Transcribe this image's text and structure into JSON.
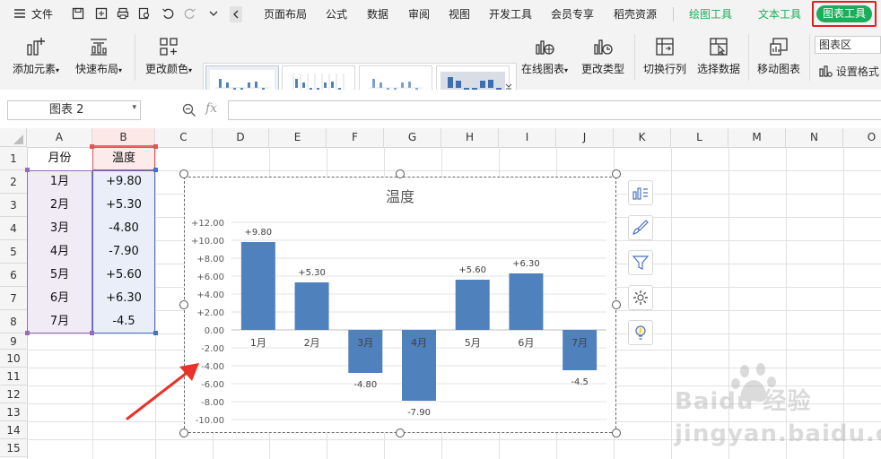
{
  "menu": {
    "file": "文件",
    "tabs": [
      "页面布局",
      "公式",
      "数据",
      "审阅",
      "视图",
      "开发工具",
      "会员专享",
      "稻壳资源"
    ],
    "draw_tools": "绘图工具",
    "text_tools": "文本工具",
    "chart_tools": "图表工具"
  },
  "ribbon": {
    "add_element": "添加元素",
    "quick_layout": "快速布局",
    "change_color": "更改颜色",
    "online_chart": "在线图表",
    "change_type": "更改类型",
    "switch_row_col": "切换行列",
    "select_data": "选择数据",
    "move_chart": "移动图表",
    "chart_area": "图表区",
    "set_format": "设置格式"
  },
  "formula_bar": {
    "name_box": "图表 2",
    "fx": "fx"
  },
  "columns": [
    "A",
    "B",
    "C",
    "D",
    "E",
    "F",
    "G",
    "H",
    "I",
    "J",
    "K",
    "L",
    "M",
    "N",
    "O"
  ],
  "rows": [
    "1",
    "2",
    "3",
    "4",
    "5",
    "6",
    "7",
    "8",
    "9",
    "10",
    "11",
    "12",
    "13",
    "14",
    "15"
  ],
  "table": {
    "header_month": "月份",
    "header_temp": "温度",
    "months": [
      "1月",
      "2月",
      "3月",
      "4月",
      "5月",
      "6月",
      "7月"
    ],
    "temps": [
      "+9.80",
      "+5.30",
      "-4.80",
      "-7.90",
      "+5.60",
      "+6.30",
      "-4.5"
    ]
  },
  "chart_data": {
    "type": "bar",
    "title": "温度",
    "categories": [
      "1月",
      "2月",
      "3月",
      "4月",
      "5月",
      "6月",
      "7月"
    ],
    "values": [
      9.8,
      5.3,
      -4.8,
      -7.9,
      5.6,
      6.3,
      -4.5
    ],
    "data_labels": [
      "+9.80",
      "+5.30",
      "-4.80",
      "-7.90",
      "+5.60",
      "+6.30",
      "-4.5"
    ],
    "yticks": [
      "+12.00",
      "+10.00",
      "+8.00",
      "+6.00",
      "+4.00",
      "+2.00",
      "0.00",
      "-2.00",
      "-4.00",
      "-6.00",
      "-8.00",
      "-10.00"
    ],
    "ylim": [
      -10,
      12
    ],
    "grid": true,
    "bar_color": "#4f81bd"
  },
  "colors": {
    "accent_green": "#1aad5a",
    "highlight_red": "#e02020",
    "arrow_red": "#e8322a"
  },
  "watermark": "Baidu 经验 jingyan.baidu.com"
}
